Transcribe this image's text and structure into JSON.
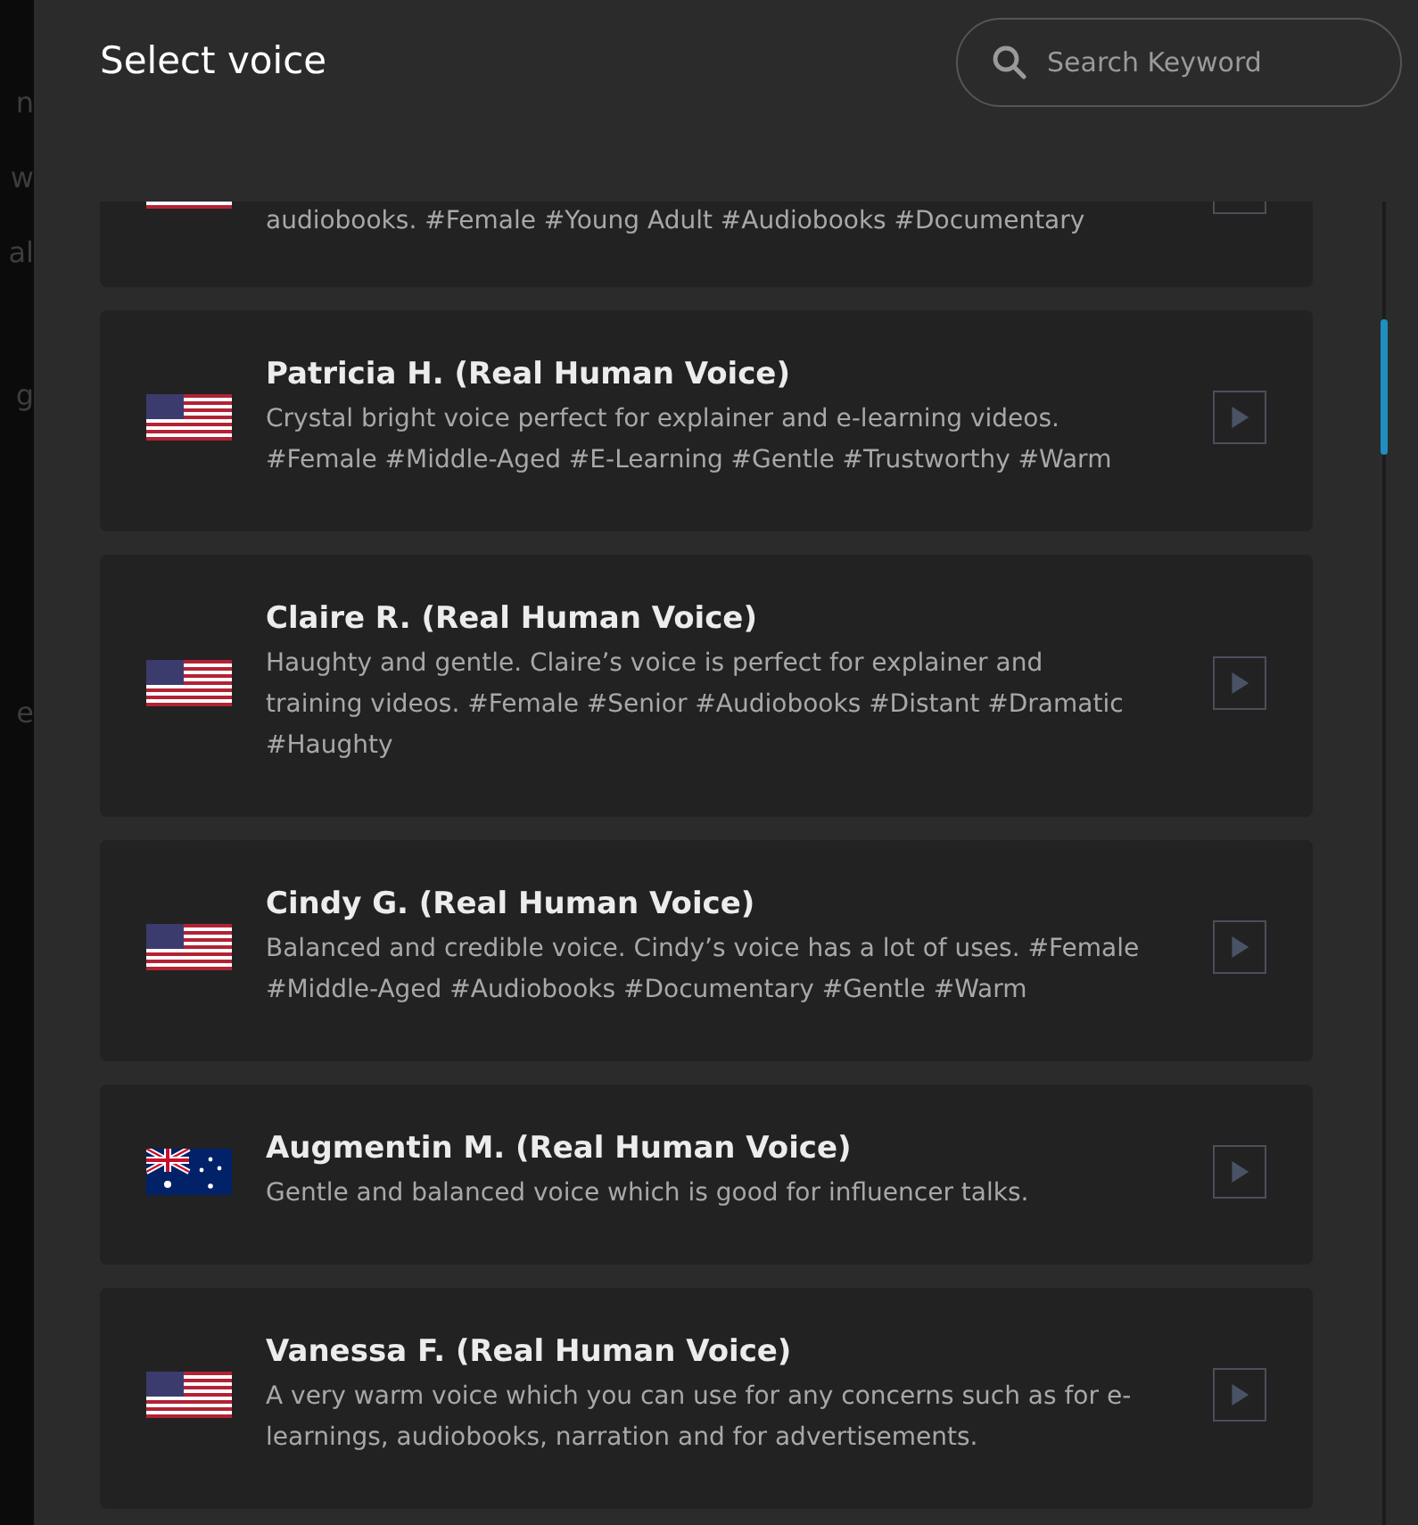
{
  "backdrop_fragments": [
    "n",
    "w",
    "al",
    "g",
    "e"
  ],
  "dialog": {
    "title": "Select voice",
    "search": {
      "placeholder": "Search Keyword"
    }
  },
  "partial_voice": {
    "description": "audiobooks. #Female #Young Adult #Audiobooks #Documentary"
  },
  "voices": [
    {
      "flag": {
        "kind": "us"
      },
      "name": "Patricia H. (Real Human Voice)",
      "description": "Crystal bright voice perfect for explainer and e-learning videos. #Female #Middle-Aged #E-Learning #Gentle #Trustworthy #Warm"
    },
    {
      "flag": {
        "kind": "us"
      },
      "name": "Claire R. (Real Human Voice)",
      "description": "Haughty and gentle. Claire’s voice is perfect for explainer and training videos. #Female #Senior #Audiobooks #Distant #Dramatic #Haughty"
    },
    {
      "flag": {
        "kind": "us"
      },
      "name": "Cindy G. (Real Human Voice)",
      "description": "Balanced and credible voice. Cindy’s voice has a lot of uses. #Female #Middle-Aged #Audiobooks #Documentary #Gentle #Warm"
    },
    {
      "flag": {
        "kind": "au"
      },
      "name": "Augmentin M. (Real Human Voice)",
      "description": "Gentle and balanced voice which is good for influencer talks."
    },
    {
      "flag": {
        "kind": "us"
      },
      "name": "Vanessa F. (Real Human Voice)",
      "description": "A very warm voice which you can use for any concerns such as for e-learnings, audiobooks, narration and for advertisements."
    }
  ]
}
